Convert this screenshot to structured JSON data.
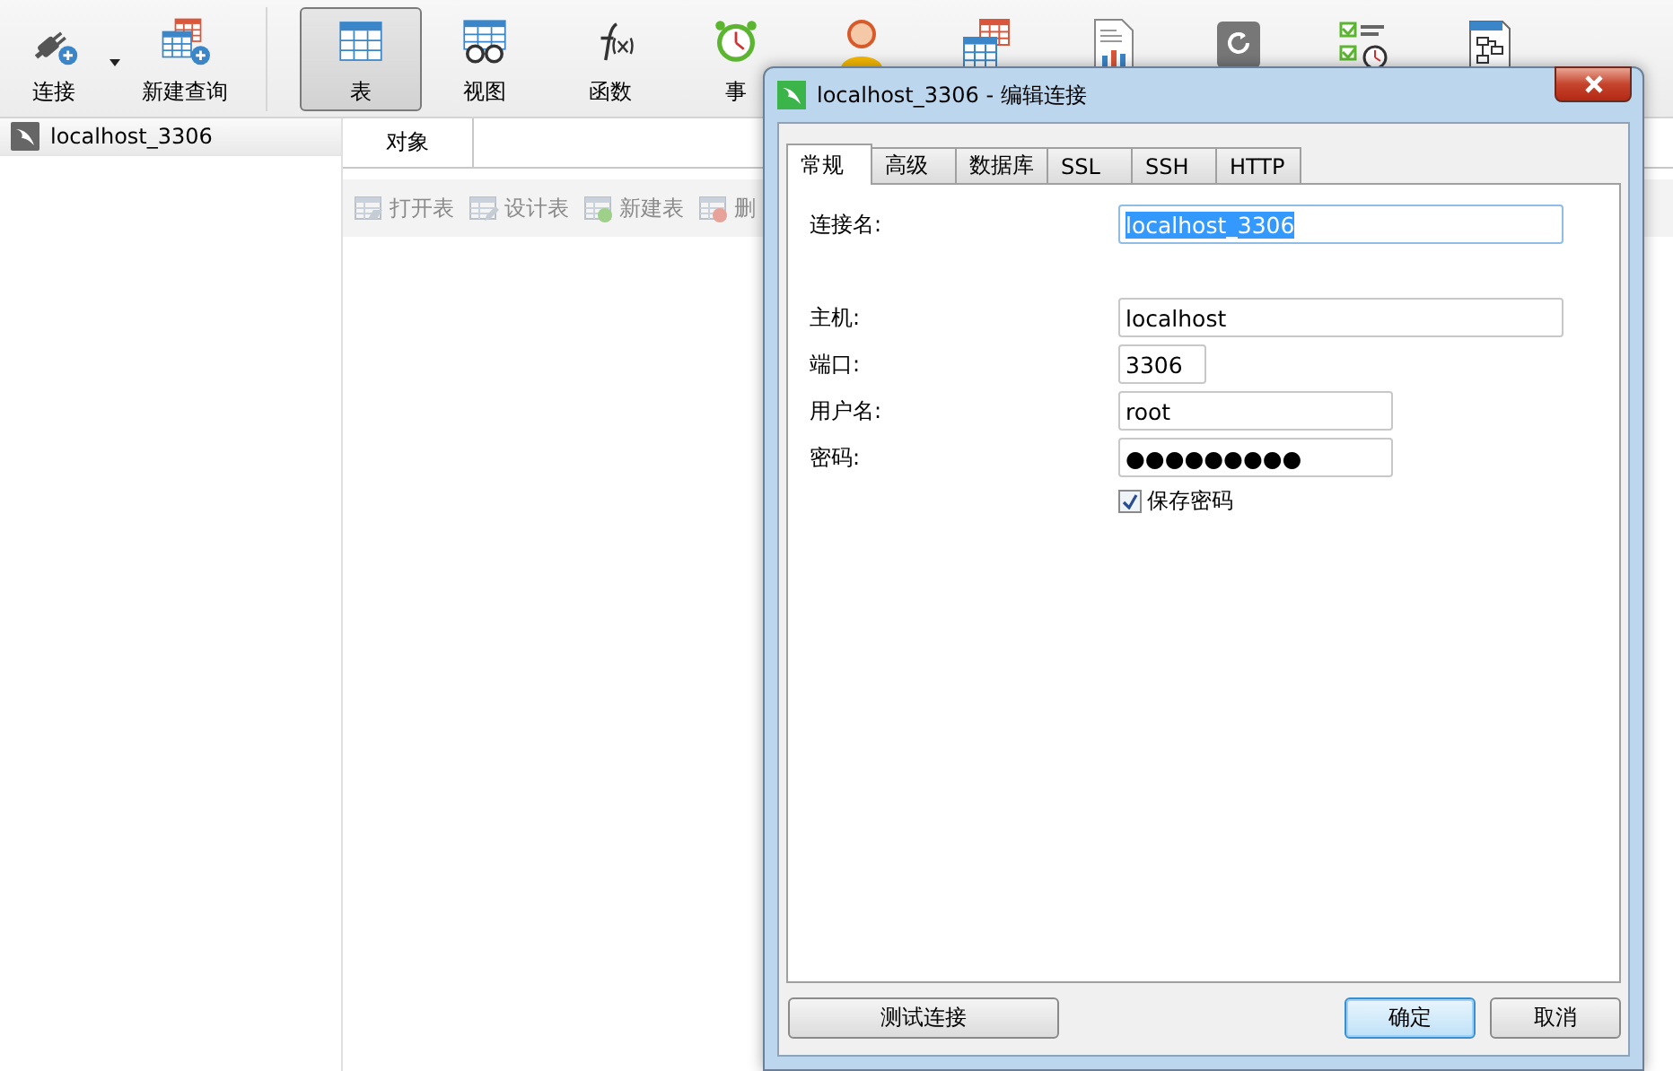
{
  "toolbar": {
    "items": [
      {
        "kind": "connect",
        "label": "连接",
        "selected": false,
        "has_menu": true
      },
      {
        "kind": "query",
        "label": "新建查询",
        "selected": false
      },
      {
        "kind": "table",
        "label": "表",
        "selected": true
      },
      {
        "kind": "view",
        "label": "视图",
        "selected": false
      },
      {
        "kind": "function",
        "label": "函数",
        "selected": false
      },
      {
        "kind": "event",
        "label": "事",
        "selected": false
      },
      {
        "kind": "user",
        "selected": false
      },
      {
        "kind": "other",
        "selected": false
      },
      {
        "kind": "report",
        "selected": false
      },
      {
        "kind": "backup",
        "selected": false
      },
      {
        "kind": "schedule",
        "selected": false
      },
      {
        "kind": "model",
        "selected": false
      }
    ]
  },
  "navigation": {
    "items": [
      {
        "name": "localhost_3306",
        "selected": true
      }
    ]
  },
  "object_tabs": [
    {
      "label": "对象",
      "selected": true
    }
  ],
  "object_toolbar": [
    {
      "kind": "open",
      "label": "打开表",
      "disabled": true
    },
    {
      "kind": "design",
      "label": "设计表",
      "disabled": true
    },
    {
      "kind": "new",
      "label": "新建表",
      "disabled": true
    },
    {
      "kind": "delete",
      "label": "删",
      "disabled": true
    }
  ],
  "dialog": {
    "title": "localhost_3306 - 编辑连接",
    "tabs": [
      {
        "label": "常规",
        "selected": true
      },
      {
        "label": "高级",
        "selected": false
      },
      {
        "label": "数据库",
        "selected": false
      },
      {
        "label": "SSL",
        "selected": false
      },
      {
        "label": "SSH",
        "selected": false
      },
      {
        "label": "HTTP",
        "selected": false
      }
    ],
    "fields": [
      {
        "kind": "name",
        "label": "连接名:",
        "value": "localhost_3306",
        "text_selected": true
      },
      {
        "kind": "host",
        "label": "主机:",
        "value": "localhost"
      },
      {
        "kind": "port",
        "label": "端口:",
        "value": "3306"
      },
      {
        "kind": "user",
        "label": "用户名:",
        "value": "root"
      },
      {
        "kind": "password",
        "label": "密码:",
        "value": "●●●●●●●●●"
      }
    ],
    "save_password": {
      "label": "保存密码",
      "checked": true
    },
    "buttons": [
      {
        "label": "测试连接",
        "default": false
      },
      {
        "label": "确定",
        "default": true
      },
      {
        "label": "取消",
        "default": false
      }
    ]
  }
}
